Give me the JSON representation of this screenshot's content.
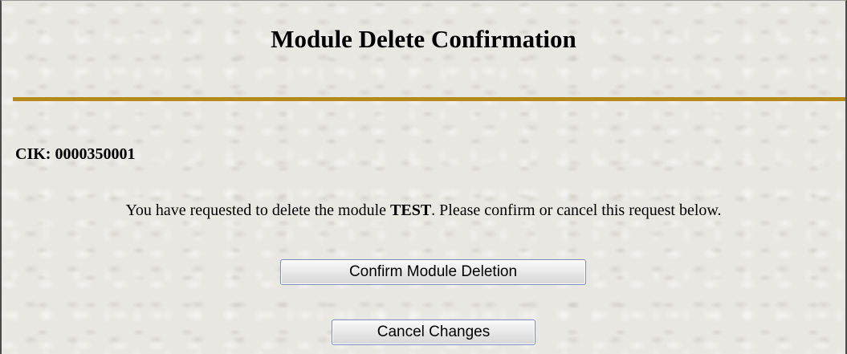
{
  "page": {
    "title": "Module Delete Confirmation",
    "cik_label": "CIK: 0000350001",
    "message": {
      "before": "You have requested to delete the module ",
      "module_name": "TEST",
      "after": ". Please confirm or cancel this request below."
    }
  },
  "buttons": {
    "confirm_label": "Confirm Module Deletion",
    "cancel_label": "Cancel Changes"
  },
  "colors": {
    "rule": "#b58a1c",
    "background": "#e9e7e2",
    "button_border": "#7a8fb5"
  }
}
